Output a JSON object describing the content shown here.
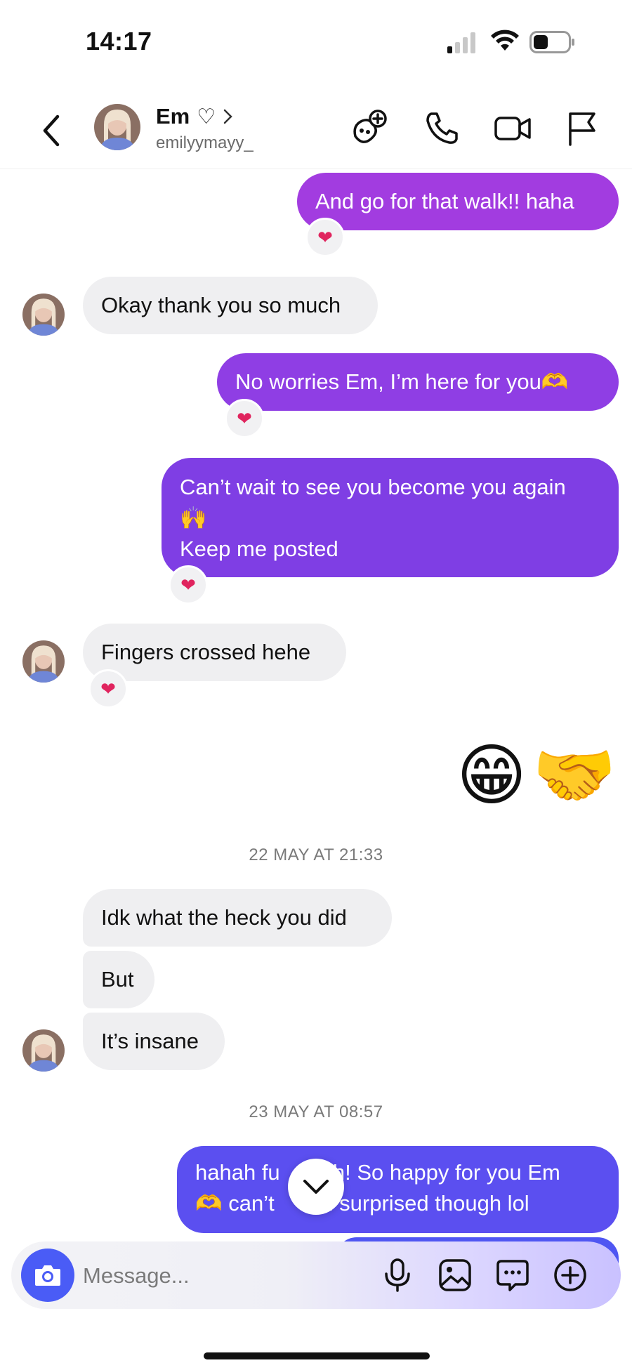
{
  "status_bar": {
    "time": "14:17"
  },
  "header": {
    "name": "Em",
    "name_suffix": "♡",
    "username": "emilyymayy_"
  },
  "icons": {
    "back": "chevron-left-icon",
    "games": "gamepad-icon",
    "call": "phone-icon",
    "video": "video-camera-icon",
    "flag": "flag-icon",
    "camera": "camera-icon",
    "mic": "microphone-icon",
    "gallery": "image-icon",
    "sticker": "chat-bubble-icon",
    "add": "plus-circle-icon"
  },
  "colors": {
    "accent": "#4a5cf6",
    "reaction": "#e0245e"
  },
  "messages": {
    "m1": {
      "text": "And go for that walk!! haha",
      "reaction": "❤"
    },
    "m2": {
      "text": "Okay thank you so much"
    },
    "m3": {
      "text": "No worries Em, I’m here for you🫶",
      "reaction": "❤"
    },
    "m4": {
      "line1": "Can’t wait to see you become you again",
      "line2": "🙌",
      "line3": "Keep me posted",
      "reaction": "❤"
    },
    "m5": {
      "text": "Fingers crossed hehe",
      "reaction": "❤"
    },
    "m6": {
      "emoji1": "😁",
      "emoji2": "🤝"
    },
    "ts1": "22 MAY AT 21:33",
    "m7": {
      "text": "Idk what the heck you did"
    },
    "m8": {
      "text": "But"
    },
    "m9": {
      "text": "It’s insane"
    },
    "ts2": "23 MAY AT 08:57",
    "m10": {
      "line1": "hahah fu",
      "line1b": "ah! So happy for you Em",
      "line2": "🫶 can’t",
      "line2b": "m surprised though lol"
    }
  },
  "composer": {
    "placeholder": "Message..."
  }
}
